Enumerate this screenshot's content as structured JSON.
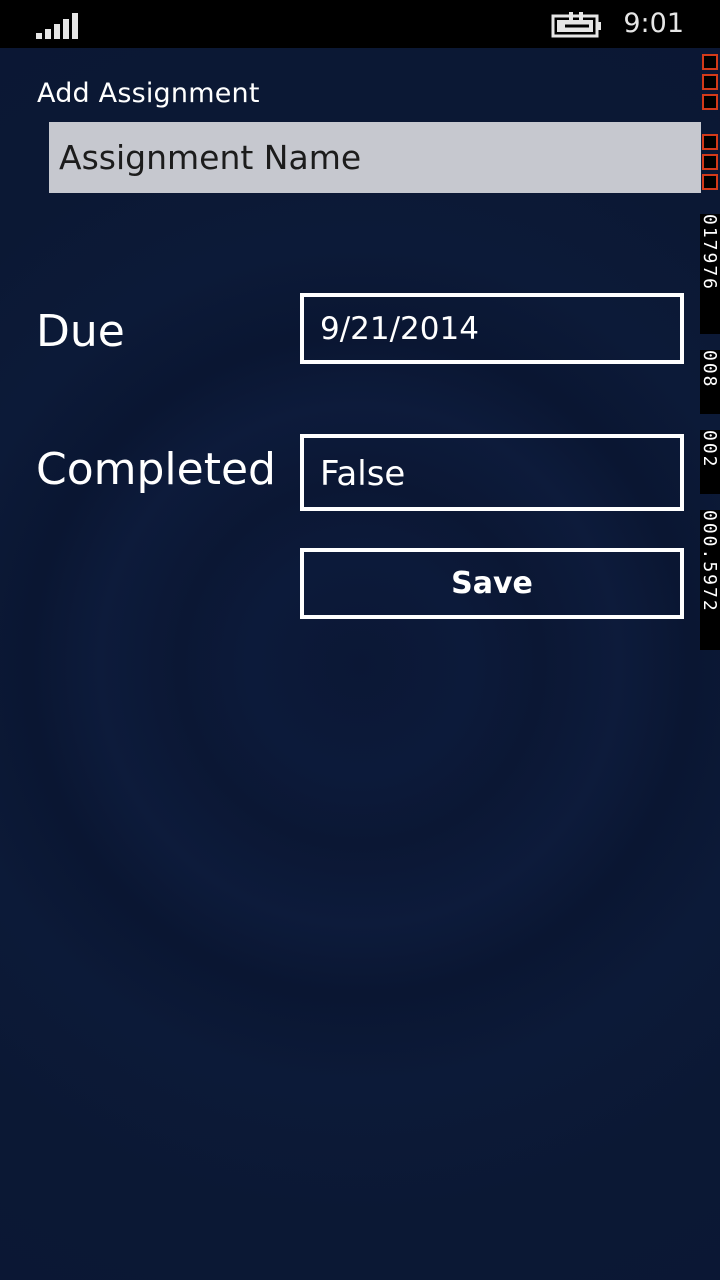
{
  "status_bar": {
    "time": "9:01",
    "signal_icon": "signal-strength-icon",
    "battery_icon": "battery-charging-icon"
  },
  "page": {
    "title": "Add Assignment"
  },
  "form": {
    "name_placeholder": "Assignment Name",
    "due_label": "Due",
    "due_value": "9/21/2014",
    "completed_label": "Completed",
    "completed_value": "False",
    "save_label": "Save"
  },
  "debug_counter": {
    "values": [
      "017976",
      "008",
      "002",
      "000.5972"
    ]
  },
  "colors": {
    "background": "#0b1633",
    "input_background": "#c6c8cf",
    "border": "#ffffff",
    "counter_red": "#d43a1a"
  }
}
